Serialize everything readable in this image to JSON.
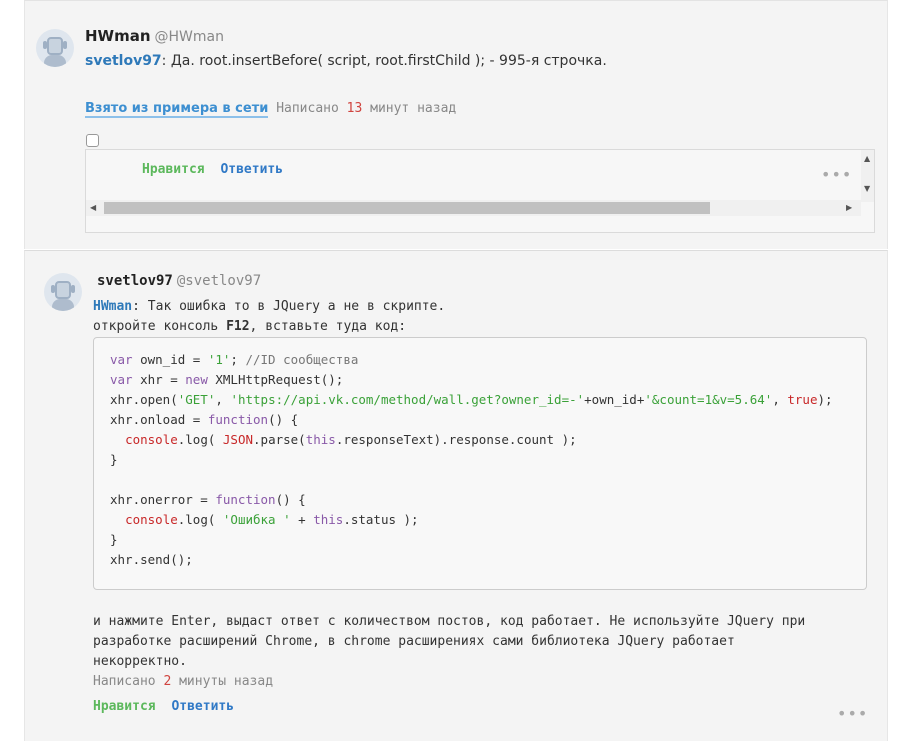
{
  "comment1": {
    "author_name": "HWman",
    "author_handle": "@HWman",
    "mention": "svetlov97",
    "text": ": Да. root.insertBefore( script, root.firstChild ); - 995-я строчка.",
    "solution_label": "Взято из примера в сети",
    "written_prefix": "Написано",
    "written_num": "13",
    "written_suffix": "минут назад",
    "frame": {
      "like": "Нравится",
      "reply": "Ответить",
      "more": "•••",
      "scroll_up": "▲",
      "scroll_down": "▼",
      "scroll_left": "◀",
      "scroll_right": "▶"
    }
  },
  "comment2": {
    "author_name": "svetlov97",
    "author_handle": "@svetlov97",
    "mention": "HWman",
    "line1": ": Так ошибка то в JQuery а не в скрипте.",
    "line2_pre": "откройте консоль ",
    "line2_key": "F12",
    "line2_post": ", вставьте туда код:",
    "code": {
      "l1_kw": "var",
      "l1_rest": " own_id = ",
      "l1_str": "'1'",
      "l1_tail": "; ",
      "l1_cm": "//ID сообщества",
      "l2_kw": "var",
      "l2_rest": " xhr = ",
      "l2_new": "new",
      "l2_tail": " XMLHttpRequest();",
      "l3_a": "xhr.open(",
      "l3_s1": "'GET'",
      "l3_b": ", ",
      "l3_s2": "'https://api.vk.com/method/wall.get?owner_id=-'",
      "l3_c": "+own_id+",
      "l3_s3": "'&count=1&v=5.64'",
      "l3_d": ", ",
      "l3_true": "true",
      "l3_e": ");",
      "l4_a": "xhr.onload = ",
      "l4_fn": "function",
      "l4_b": "() {",
      "l5_obj": "console",
      "l5_a": ".log( ",
      "l5_json": "JSON",
      "l5_b": ".parse(",
      "l5_this": "this",
      "l5_c": ".responseText).response.count );",
      "l6": "}",
      "l8_a": "xhr.onerror = ",
      "l8_fn": "function",
      "l8_b": "() {",
      "l9_obj": "console",
      "l9_a": ".log( ",
      "l9_str": "'Ошибка '",
      "l9_b": " + ",
      "l9_this": "this",
      "l9_c": ".status );",
      "l10": "}",
      "l11": "xhr.send();"
    },
    "after1": "и нажмите Enter, выдаст ответ с количеством постов, код работает. Не используйте JQuery при",
    "after2": "разработке расширений Chrome, в chrome расширениях сами библиотека JQuery работает",
    "after3": "некорректно.",
    "written_prefix": "Написано",
    "written_num": "2",
    "written_suffix": "минуты назад",
    "like": "Нравится",
    "reply": "Ответить",
    "more": "•••"
  }
}
